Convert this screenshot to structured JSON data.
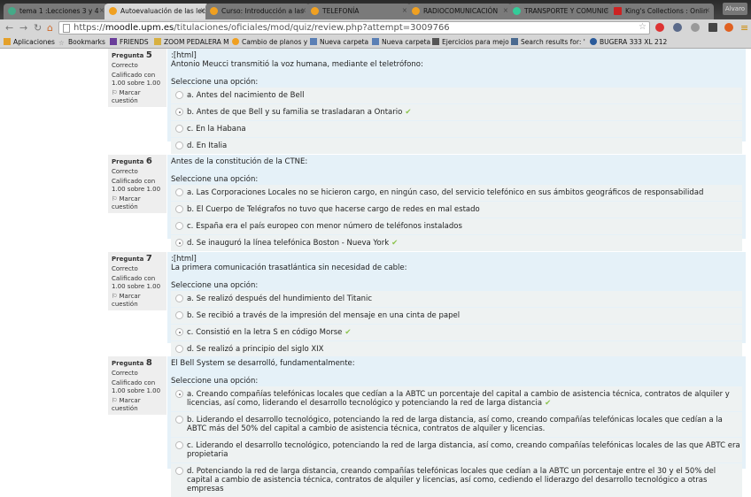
{
  "browser": {
    "tabs": [
      "tema 1 :Lecciones 3 y 4",
      "Autoevaluación de las lecc",
      "Curso: Introducción a las",
      "TELEFONÍA",
      "RADIOCOMUNICACIÓN",
      "TRANSPORTE Y COMUNIC",
      "King's Collections : Onlin"
    ],
    "user": "Alvaro",
    "url_prefix": "https://",
    "url_host": "moodle.upm.es",
    "url_path": "/titulaciones/oficiales/mod/quiz/review.php?attempt=3009766",
    "bookmarks": [
      "Aplicaciones",
      "Bookmarks",
      "FRIENDS",
      "ZOOM PEDALERA M",
      "Cambio de planos y",
      "Nueva carpeta",
      "Nueva carpeta",
      "Ejercicios para mejo",
      "Search results for: '",
      "BUGERA 333 XL 212"
    ]
  },
  "common": {
    "pregunta": "Pregunta",
    "estado": "Correcto",
    "calificado": "Calificado con 1.00 sobre 1.00",
    "marcar": "Marcar cuestión",
    "seleccione": "Seleccione una opción:",
    "check": "✔"
  },
  "questions": [
    {
      "num": "5",
      "prefix": ":[html]",
      "text": "Antonio Meucci transmitió la voz humana, mediante el teletrófono:",
      "options": [
        "a. Antes del nacimiento de Bell",
        "b. Antes de que Bell y su familia se trasladaran a Ontario",
        "c. En la Habana",
        "d. En Italia"
      ],
      "selected": 1
    },
    {
      "num": "6",
      "prefix": "",
      "text": "Antes de la constitución de la CTNE:",
      "options": [
        "a. Las Corporaciones Locales no se hicieron cargo, en ningún caso, del servicio telefónico en sus ámbitos geográficos de responsabilidad",
        "b. El Cuerpo de Telégrafos no tuvo que hacerse cargo de redes en mal estado",
        "c. España era el país europeo con menor número de teléfonos instalados",
        "d. Se inauguró la línea telefónica Boston - Nueva York"
      ],
      "selected": 3
    },
    {
      "num": "7",
      "prefix": ":[html]",
      "text": "La primera comunicación trasatlántica sin necesidad de cable:",
      "options": [
        "a. Se realizó después del hundimiento del Titanic",
        "b. Se recibió a través de la impresión del mensaje en una cinta de papel",
        "c. Consistió en la letra S en código Morse",
        "d. Se realizó a principio del siglo XIX"
      ],
      "selected": 2
    },
    {
      "num": "8",
      "prefix": "",
      "text": "El Bell System se desarrolló, fundamentalmente:",
      "options": [
        "a. Creando compañías telefónicas locales que cedían a la ABTC un porcentaje del capital a cambio de asistencia técnica, contratos de alquiler y licencias, así como, liderando el desarrollo tecnológico y potenciando la red de larga distancia",
        "b. Liderando el desarrollo tecnológico, potenciando la red de larga distancia, así como, creando compañías telefónicas locales que cedían a la ABTC más del 50% del capital a cambio de asistencia técnica, contratos de alquiler y licencias.",
        "c. Liderando el desarrollo tecnológico, potenciando la red de larga distancia, así como, creando compañías telefónicas locales de las que ABTC era propietaria",
        "d. Potenciando la red de larga distancia, creando compañías telefónicas locales que cedían a la ABTC un porcentaje entre el 30 y el 50% del capital a cambio de asistencia técnica, contratos de alquiler y licencias, así como, cediendo el liderazgo del desarrollo tecnológico a otras empresas"
      ],
      "selected": 0
    }
  ]
}
